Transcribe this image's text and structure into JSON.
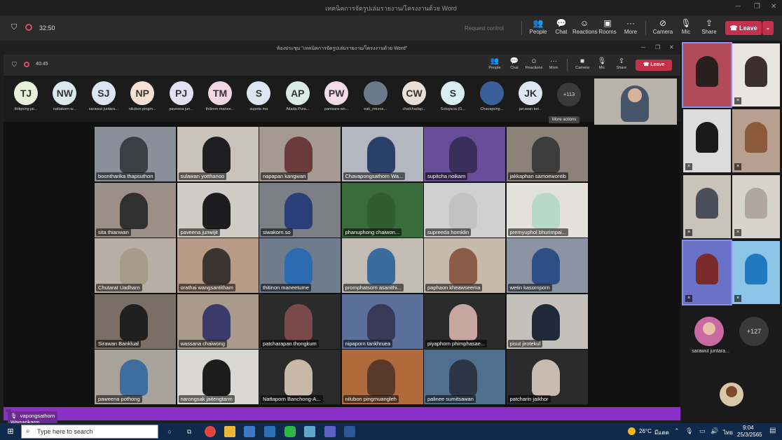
{
  "window": {
    "title": "เทคนิคการจัดรูปเล่มรายงาน/โครงงานด้วย Word"
  },
  "outer_bar": {
    "timer": "32:50",
    "request_control": "Request control",
    "controls": [
      {
        "label": "People",
        "icon": "people-icon"
      },
      {
        "label": "Chat",
        "icon": "chat-icon"
      },
      {
        "label": "Reactions",
        "icon": "reactions-icon"
      },
      {
        "label": "Rooms",
        "icon": "rooms-icon"
      },
      {
        "label": "More",
        "icon": "more-icon"
      },
      {
        "label": "Camera",
        "icon": "camera-off-icon"
      },
      {
        "label": "Mic",
        "icon": "mic-off-icon"
      },
      {
        "label": "Share",
        "icon": "share-icon"
      }
    ],
    "leave": "Leave"
  },
  "inner": {
    "title": "ห้องประชุม \"เทคนิคการจัดรูปเล่มรายงาน/โครงงานด้วย Word\"",
    "timer": "40:45",
    "controls": [
      {
        "label": "People"
      },
      {
        "label": "Chat"
      },
      {
        "label": "Reactions"
      },
      {
        "label": "More"
      },
      {
        "label": "Camera"
      },
      {
        "label": "Mic"
      },
      {
        "label": "Share"
      }
    ],
    "leave": "Leave",
    "tooltip": "More actions",
    "avatars": [
      {
        "initials": "TJ",
        "name": "thitipong jai...",
        "color": "#e9f0d8"
      },
      {
        "initials": "NW",
        "name": "nattakorn w...",
        "color": "#dbe9ec"
      },
      {
        "initials": "SJ",
        "name": "sarawut juntara...",
        "color": "#dce3f5"
      },
      {
        "initials": "NP",
        "name": "nilubon pingm...",
        "color": "#f6e0d4"
      },
      {
        "initials": "PJ",
        "name": "paveena jun...",
        "color": "#e2e0f3"
      },
      {
        "initials": "TM",
        "name": "thitinon manee...",
        "color": "#f2d6e3"
      },
      {
        "initials": "S",
        "name": "supote.ma",
        "color": "#dce6f2"
      },
      {
        "initials": "AP",
        "name": "Ailada Pura...",
        "color": "#d9ede6"
      },
      {
        "initials": "PW",
        "name": "panisara wo...",
        "color": "#f3dbe9"
      },
      {
        "initials": "",
        "name": "eak_micros...",
        "color": "#6b7a8a"
      },
      {
        "initials": "CW",
        "name": "chatchadap...",
        "color": "#eadfd6"
      },
      {
        "initials": "S",
        "name": "Sotaya.ta (G...",
        "color": "#d9eef0"
      },
      {
        "initials": "",
        "name": "Chavapong...",
        "color": "#3a5f9a"
      },
      {
        "initials": "JK",
        "name": "jaruwan ket...",
        "color": "#dfe4f2"
      }
    ],
    "overflow_count": "+113",
    "gallery": [
      "boontharika thapsuthon",
      "sulawan yotthanoo",
      "napapan kangwan",
      "Chavapongsathorn Wa...",
      "supitcha noikam",
      "jakkaphan samoewontib",
      "sita thianwan",
      "paveena junwijit",
      "siwakorn.so",
      "phanuphong chaiwon...",
      "supreeda homklin",
      "premyuphol bhurimpai...",
      "Chutarat Uadharn",
      "orathai wangsantitham",
      "thitinon maneetume",
      "promphatsorn asanithi...",
      "paphaon kheawseema",
      "wetin kasornporn",
      "Sirawan Banklual",
      "wassana chaiwong",
      "patcharapan thongkum",
      "nipaporn tankhruea",
      "piyaphorn phimphasae...",
      "pisut jirotekul",
      "paweena pothong",
      "narongsak jaitengtarm",
      "Nattaporn Banchong-A...",
      "nilubon pingmuangleh",
      "palinee sumitsawan",
      "patcharin jaikhor"
    ],
    "speaker": "Chavapongsathorn Waisarikarm"
  },
  "right_panel": {
    "person_label": "sarawut juntara...",
    "overflow_count": "+127"
  },
  "taskbar": {
    "search_placeholder": "Type here to search",
    "temperature": "26°C",
    "weather": "มีแดด",
    "lang": "ไทย",
    "time": "9:04",
    "date": "25/3/2565"
  }
}
